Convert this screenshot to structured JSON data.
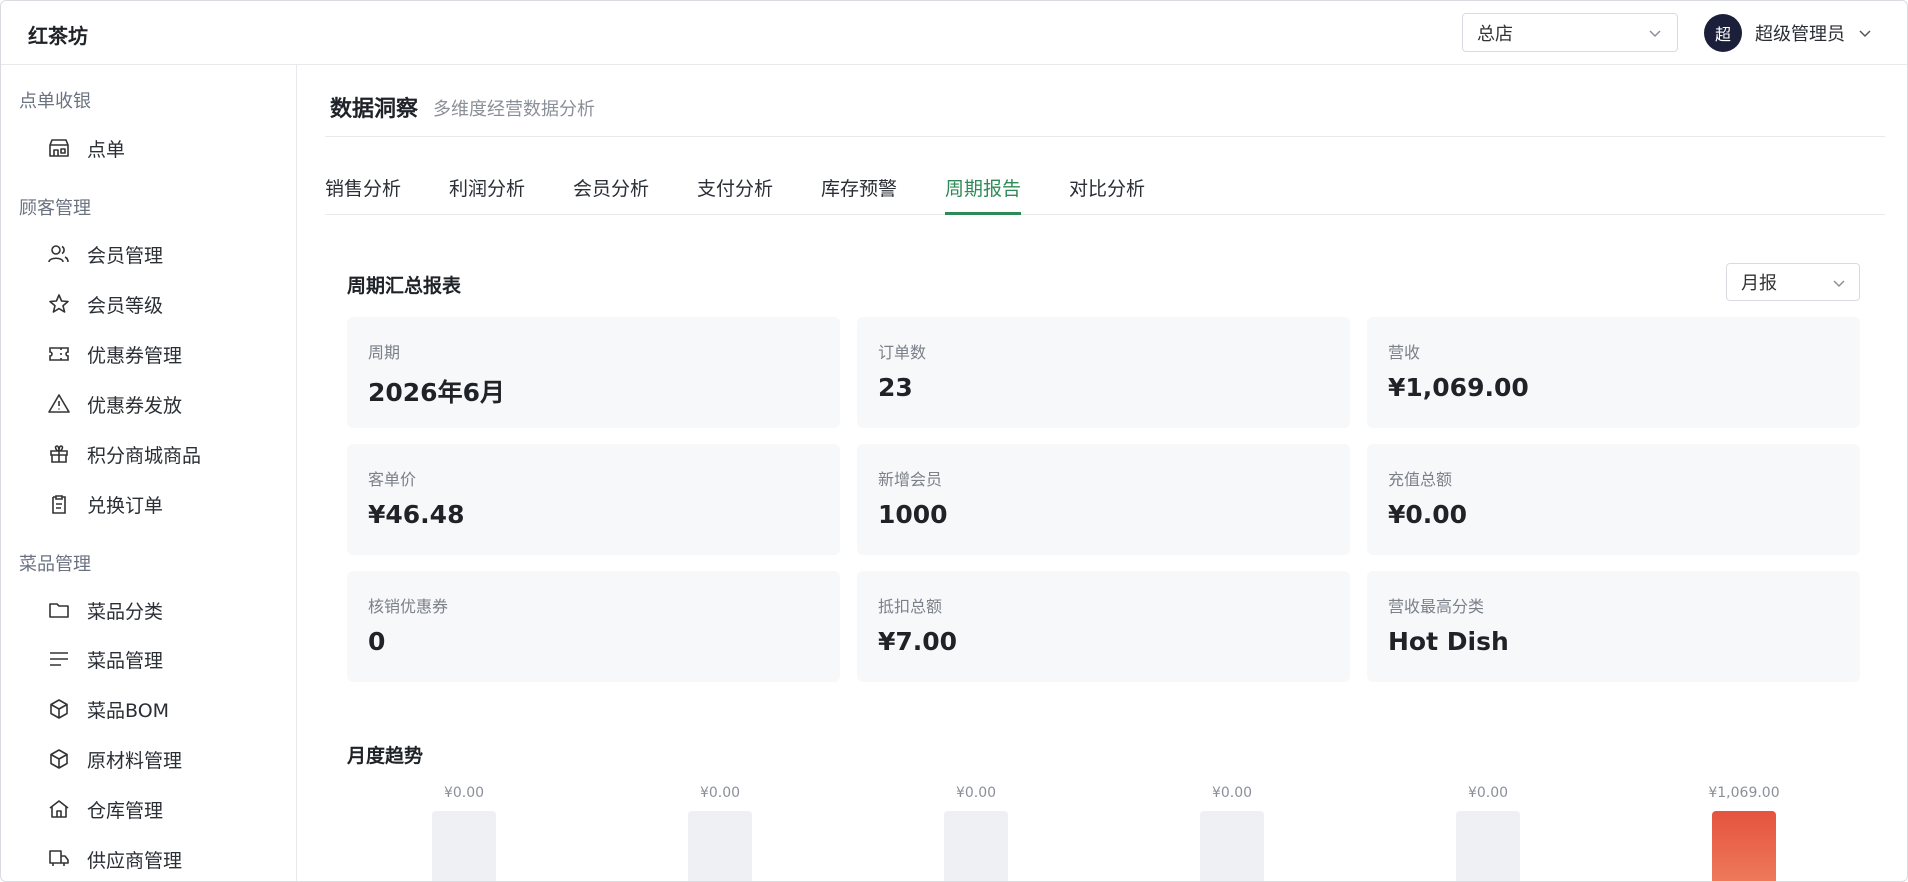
{
  "app": {
    "brand": "红茶坊"
  },
  "header": {
    "store_select": {
      "value": "总店"
    },
    "user": {
      "avatar_text": "超",
      "name": "超级管理员"
    }
  },
  "sidebar": {
    "groups": [
      {
        "title": "点单收银",
        "items": [
          {
            "label": "点单",
            "icon": "store-icon"
          }
        ]
      },
      {
        "title": "顾客管理",
        "items": [
          {
            "label": "会员管理",
            "icon": "users-icon"
          },
          {
            "label": "会员等级",
            "icon": "star-icon"
          },
          {
            "label": "优惠券管理",
            "icon": "ticket-icon"
          },
          {
            "label": "优惠券发放",
            "icon": "warning-triangle-icon"
          },
          {
            "label": "积分商城商品",
            "icon": "gift-box-icon"
          },
          {
            "label": "兑换订单",
            "icon": "clipboard-icon"
          }
        ]
      },
      {
        "title": "菜品管理",
        "items": [
          {
            "label": "菜品分类",
            "icon": "folder-icon"
          },
          {
            "label": "菜品管理",
            "icon": "list-icon"
          },
          {
            "label": "菜品BOM",
            "icon": "cube-icon"
          },
          {
            "label": "原材料管理",
            "icon": "cube-icon"
          },
          {
            "label": "仓库管理",
            "icon": "home-icon"
          },
          {
            "label": "供应商管理",
            "icon": "truck-icon"
          }
        ]
      }
    ]
  },
  "page": {
    "title": "数据洞察",
    "subtitle": "多维度经营数据分析",
    "tabs": [
      {
        "label": "销售分析",
        "active": false
      },
      {
        "label": "利润分析",
        "active": false
      },
      {
        "label": "会员分析",
        "active": false
      },
      {
        "label": "支付分析",
        "active": false
      },
      {
        "label": "库存预警",
        "active": false
      },
      {
        "label": "周期报告",
        "active": true
      },
      {
        "label": "对比分析",
        "active": false
      }
    ]
  },
  "summary": {
    "title": "周期汇总报表",
    "period_select": {
      "value": "月报"
    },
    "cards": [
      {
        "label": "周期",
        "value": "2026年6月"
      },
      {
        "label": "订单数",
        "value": "23"
      },
      {
        "label": "营收",
        "value": "¥1,069.00"
      },
      {
        "label": "客单价",
        "value": "¥46.48"
      },
      {
        "label": "新增会员",
        "value": "1000"
      },
      {
        "label": "充值总额",
        "value": "¥0.00"
      },
      {
        "label": "核销优惠券",
        "value": "0"
      },
      {
        "label": "抵扣总额",
        "value": "¥7.00"
      },
      {
        "label": "营收最高分类",
        "value": "Hot Dish"
      }
    ]
  },
  "trend": {
    "title": "月度趋势"
  },
  "chart_data": {
    "type": "bar",
    "categories": [],
    "values": [
      0,
      0,
      0,
      0,
      0,
      1069
    ],
    "data_labels": [
      "¥0.00",
      "¥0.00",
      "¥0.00",
      "¥0.00",
      "¥0.00",
      "¥1,069.00"
    ],
    "highlight_color": "#e5533d",
    "bar_color": "#eef0f3"
  }
}
